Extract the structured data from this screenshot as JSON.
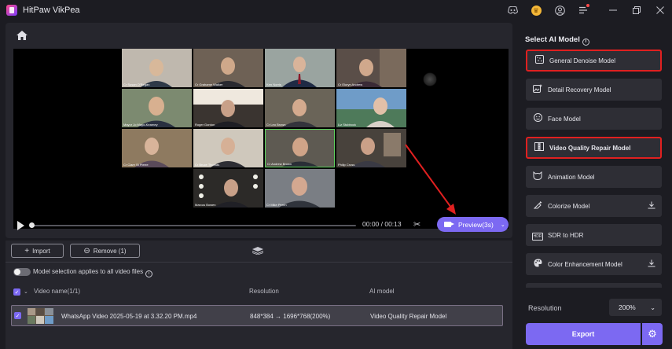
{
  "app": {
    "title": "HitPaw VikPea"
  },
  "player": {
    "time": "00:00 / 00:13",
    "preview_label": "Preview(3s)"
  },
  "participants": [
    "Cr Susan O'Regan",
    "Cr Grahame Walker",
    "Ken Norris",
    "Cr Eluryn Andrew",
    "Mayor Jo Mayo-Kearney",
    "Roger Gordon",
    "Cr Leo Brown",
    "Liz Stubbock",
    "Cr Clare St Pierre",
    "Cr Bruce Thomas",
    "Cr Andrew Brown",
    "Philip Cross",
    "Marcus Bowen",
    "Cr Mike Perrin"
  ],
  "toolbar": {
    "import_label": "Import",
    "remove_label": "Remove (1)"
  },
  "settings": {
    "apply_all_label": "Model selection applies to all video files"
  },
  "table": {
    "col_name": "Video name(1/1)",
    "col_resolution": "Resolution",
    "col_model": "AI model",
    "rows": [
      {
        "name": "WhatsApp Video 2025-05-19 at 3.32.20 PM.mp4",
        "resolution": "848*384 → 1696*768(200%)",
        "model": "Video Quality Repair Model"
      }
    ]
  },
  "sidebar": {
    "title": "Select AI Model",
    "models": [
      {
        "label": "General Denoise Model",
        "icon": "denoise-icon"
      },
      {
        "label": "Detail Recovery Model",
        "icon": "detail-icon"
      },
      {
        "label": "Face Model",
        "icon": "face-icon"
      },
      {
        "label": "Video Quality Repair Model",
        "icon": "repair-icon"
      },
      {
        "label": "Animation Model",
        "icon": "animation-icon"
      },
      {
        "label": "Colorize Model",
        "icon": "colorize-icon"
      },
      {
        "label": "SDR to HDR",
        "icon": "hdr-icon"
      },
      {
        "label": "Color Enhancement Model",
        "icon": "palette-icon"
      }
    ],
    "hdr_badge": "HDR",
    "resolution_label": "Resolution",
    "resolution_value": "200%",
    "export_label": "Export"
  },
  "colors": {
    "accent": "#7c69f2",
    "highlight": "#e02020"
  }
}
